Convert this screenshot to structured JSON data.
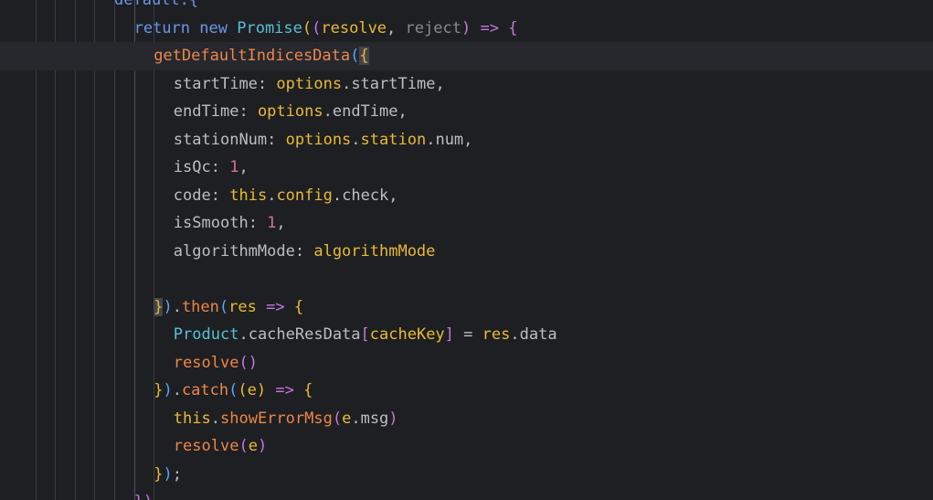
{
  "colors": {
    "background": "#1e1f22",
    "current_line": "#26282e",
    "indent_guide": "#393b40",
    "brace_match": "#43454a",
    "keyword": "#cf8e6d",
    "keyword_blue": "#6c95eb",
    "function": "#56a8f5",
    "class": "#c77dbb",
    "property": "#c77dbb",
    "number": "#2aacb8",
    "string": "#6aab73",
    "plain": "#bcbec4",
    "unused_param": "#868a91",
    "bracket_gold": "#e8ba36",
    "bracket_purple": "#c678dd",
    "bracket_blue": "#5aa7f5"
  },
  "code": {
    "lines": [
      {
        "indent": 5,
        "tokens": [
          {
            "t": "default.{",
            "c": "#6c95eb"
          }
        ]
      },
      {
        "indent": 6,
        "tokens": [
          {
            "t": "return",
            "c": "#6c95eb"
          },
          {
            "t": " ",
            "c": "#bcbec4"
          },
          {
            "t": "new",
            "c": "#6c95eb"
          },
          {
            "t": " ",
            "c": "#bcbec4"
          },
          {
            "t": "Promise",
            "c": "#56c1d6"
          },
          {
            "t": "(",
            "c": "#e8ba36"
          },
          {
            "t": "(",
            "c": "#c678dd"
          },
          {
            "t": "resolve",
            "c": "#e8ba36"
          },
          {
            "t": ", ",
            "c": "#bcbec4"
          },
          {
            "t": "reject",
            "c": "#868a91"
          },
          {
            "t": ")",
            "c": "#c678dd"
          },
          {
            "t": " ",
            "c": "#bcbec4"
          },
          {
            "t": "=>",
            "c": "#c678dd"
          },
          {
            "t": " ",
            "c": "#bcbec4"
          },
          {
            "t": "{",
            "c": "#c678dd"
          }
        ]
      },
      {
        "indent": 7,
        "current": true,
        "tokens": [
          {
            "t": "getDefaultIndicesData",
            "c": "#ed864a"
          },
          {
            "t": "(",
            "c": "#5aa7f5"
          },
          {
            "t": "{",
            "c": "#e8ba36",
            "hl": true
          }
        ]
      },
      {
        "indent": 8,
        "tokens": [
          {
            "t": "startTime",
            "c": "#bcbec4"
          },
          {
            "t": ": ",
            "c": "#bcbec4"
          },
          {
            "t": "options",
            "c": "#e8ba36"
          },
          {
            "t": ".",
            "c": "#bcbec4"
          },
          {
            "t": "startTime",
            "c": "#bcbec4"
          },
          {
            "t": ",",
            "c": "#bcbec4"
          }
        ]
      },
      {
        "indent": 8,
        "tokens": [
          {
            "t": "endTime",
            "c": "#bcbec4"
          },
          {
            "t": ": ",
            "c": "#bcbec4"
          },
          {
            "t": "options",
            "c": "#e8ba36"
          },
          {
            "t": ".",
            "c": "#bcbec4"
          },
          {
            "t": "endTime",
            "c": "#bcbec4"
          },
          {
            "t": ",",
            "c": "#bcbec4"
          }
        ]
      },
      {
        "indent": 8,
        "tokens": [
          {
            "t": "stationNum",
            "c": "#bcbec4"
          },
          {
            "t": ": ",
            "c": "#bcbec4"
          },
          {
            "t": "options",
            "c": "#e8ba36"
          },
          {
            "t": ".",
            "c": "#bcbec4"
          },
          {
            "t": "station",
            "c": "#e8ba36"
          },
          {
            "t": ".",
            "c": "#bcbec4"
          },
          {
            "t": "num",
            "c": "#bcbec4"
          },
          {
            "t": ",",
            "c": "#bcbec4"
          }
        ]
      },
      {
        "indent": 8,
        "tokens": [
          {
            "t": "isQc",
            "c": "#bcbec4"
          },
          {
            "t": ": ",
            "c": "#bcbec4"
          },
          {
            "t": "1",
            "c": "#d36fa0"
          },
          {
            "t": ",",
            "c": "#bcbec4"
          }
        ]
      },
      {
        "indent": 8,
        "tokens": [
          {
            "t": "code",
            "c": "#bcbec4"
          },
          {
            "t": ": ",
            "c": "#bcbec4"
          },
          {
            "t": "this",
            "c": "#e8ba36"
          },
          {
            "t": ".",
            "c": "#bcbec4"
          },
          {
            "t": "config",
            "c": "#e8ba36"
          },
          {
            "t": ".",
            "c": "#bcbec4"
          },
          {
            "t": "check",
            "c": "#bcbec4"
          },
          {
            "t": ",",
            "c": "#bcbec4"
          }
        ]
      },
      {
        "indent": 8,
        "tokens": [
          {
            "t": "isSmooth",
            "c": "#bcbec4"
          },
          {
            "t": ": ",
            "c": "#bcbec4"
          },
          {
            "t": "1",
            "c": "#d36fa0"
          },
          {
            "t": ",",
            "c": "#bcbec4"
          }
        ]
      },
      {
        "indent": 8,
        "tokens": [
          {
            "t": "algorithmMode",
            "c": "#bcbec4"
          },
          {
            "t": ": ",
            "c": "#bcbec4"
          },
          {
            "t": "algorithmMode",
            "c": "#e8ba36"
          }
        ]
      },
      {
        "indent": 8,
        "tokens": []
      },
      {
        "indent": 7,
        "tokens": [
          {
            "t": "}",
            "c": "#e8ba36",
            "hl": true
          },
          {
            "t": ")",
            "c": "#5aa7f5"
          },
          {
            "t": ".",
            "c": "#bcbec4"
          },
          {
            "t": "then",
            "c": "#ed864a"
          },
          {
            "t": "(",
            "c": "#5aa7f5"
          },
          {
            "t": "res",
            "c": "#e8ba36"
          },
          {
            "t": " ",
            "c": "#bcbec4"
          },
          {
            "t": "=>",
            "c": "#c678dd"
          },
          {
            "t": " ",
            "c": "#bcbec4"
          },
          {
            "t": "{",
            "c": "#e8ba36"
          }
        ]
      },
      {
        "indent": 8,
        "tokens": [
          {
            "t": "Product",
            "c": "#56c1d6"
          },
          {
            "t": ".",
            "c": "#bcbec4"
          },
          {
            "t": "cacheResData",
            "c": "#bcbec4"
          },
          {
            "t": "[",
            "c": "#c678dd"
          },
          {
            "t": "cacheKey",
            "c": "#e8ba36"
          },
          {
            "t": "]",
            "c": "#c678dd"
          },
          {
            "t": " = ",
            "c": "#bcbec4"
          },
          {
            "t": "res",
            "c": "#e8ba36"
          },
          {
            "t": ".",
            "c": "#bcbec4"
          },
          {
            "t": "data",
            "c": "#bcbec4"
          }
        ]
      },
      {
        "indent": 8,
        "tokens": [
          {
            "t": "resolve",
            "c": "#ed864a"
          },
          {
            "t": "()",
            "c": "#c678dd"
          }
        ]
      },
      {
        "indent": 7,
        "tokens": [
          {
            "t": "}",
            "c": "#e8ba36"
          },
          {
            "t": ")",
            "c": "#5aa7f5"
          },
          {
            "t": ".",
            "c": "#bcbec4"
          },
          {
            "t": "catch",
            "c": "#ed864a"
          },
          {
            "t": "(",
            "c": "#5aa7f5"
          },
          {
            "t": "(",
            "c": "#e8ba36"
          },
          {
            "t": "e",
            "c": "#e8ba36"
          },
          {
            "t": ")",
            "c": "#e8ba36"
          },
          {
            "t": " ",
            "c": "#bcbec4"
          },
          {
            "t": "=>",
            "c": "#c678dd"
          },
          {
            "t": " ",
            "c": "#bcbec4"
          },
          {
            "t": "{",
            "c": "#e8ba36"
          }
        ]
      },
      {
        "indent": 8,
        "tokens": [
          {
            "t": "this",
            "c": "#e8ba36"
          },
          {
            "t": ".",
            "c": "#bcbec4"
          },
          {
            "t": "showErrorMsg",
            "c": "#ed864a"
          },
          {
            "t": "(",
            "c": "#c678dd"
          },
          {
            "t": "e",
            "c": "#e8ba36"
          },
          {
            "t": ".",
            "c": "#bcbec4"
          },
          {
            "t": "msg",
            "c": "#bcbec4"
          },
          {
            "t": ")",
            "c": "#c678dd"
          }
        ]
      },
      {
        "indent": 8,
        "tokens": [
          {
            "t": "resolve",
            "c": "#ed864a"
          },
          {
            "t": "(",
            "c": "#c678dd"
          },
          {
            "t": "e",
            "c": "#e8ba36"
          },
          {
            "t": ")",
            "c": "#c678dd"
          }
        ]
      },
      {
        "indent": 7,
        "tokens": [
          {
            "t": "}",
            "c": "#e8ba36"
          },
          {
            "t": ")",
            "c": "#5aa7f5"
          },
          {
            "t": ";",
            "c": "#bcbec4"
          }
        ]
      },
      {
        "indent": 6,
        "tokens": [
          {
            "t": "})",
            "c": "#c678dd"
          }
        ]
      }
    ]
  }
}
